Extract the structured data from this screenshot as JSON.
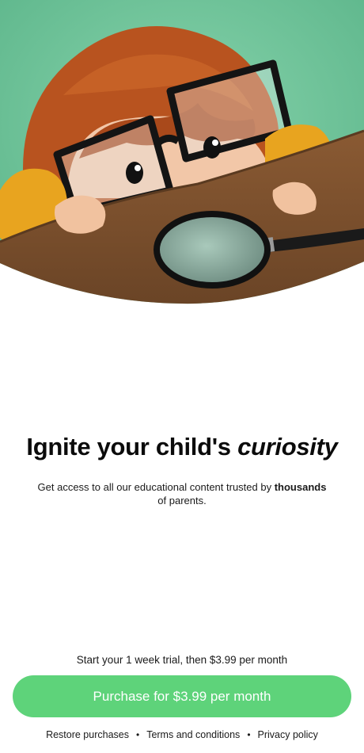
{
  "hero": {
    "illustration": "child-with-glasses-and-magnifying-glass"
  },
  "headline": {
    "main": "Ignite your child's",
    "emphasis": "curiosity"
  },
  "subtitle": {
    "text_before": "Get access to all our educational content trusted by",
    "bold": "thousands",
    "text_after": "of parents."
  },
  "trial": {
    "text": "Start your 1 week trial, then $3.99 per month"
  },
  "purchase": {
    "label": "Purchase for $3.99 per month"
  },
  "footer": {
    "restore": "Restore purchases",
    "terms": "Terms and conditions",
    "privacy": "Privacy policy",
    "separator": "•"
  },
  "colors": {
    "accent": "#5ed37a",
    "background": "#ffffff",
    "hero_wall": "#6cc39a",
    "hero_table": "#7a4f2b"
  }
}
